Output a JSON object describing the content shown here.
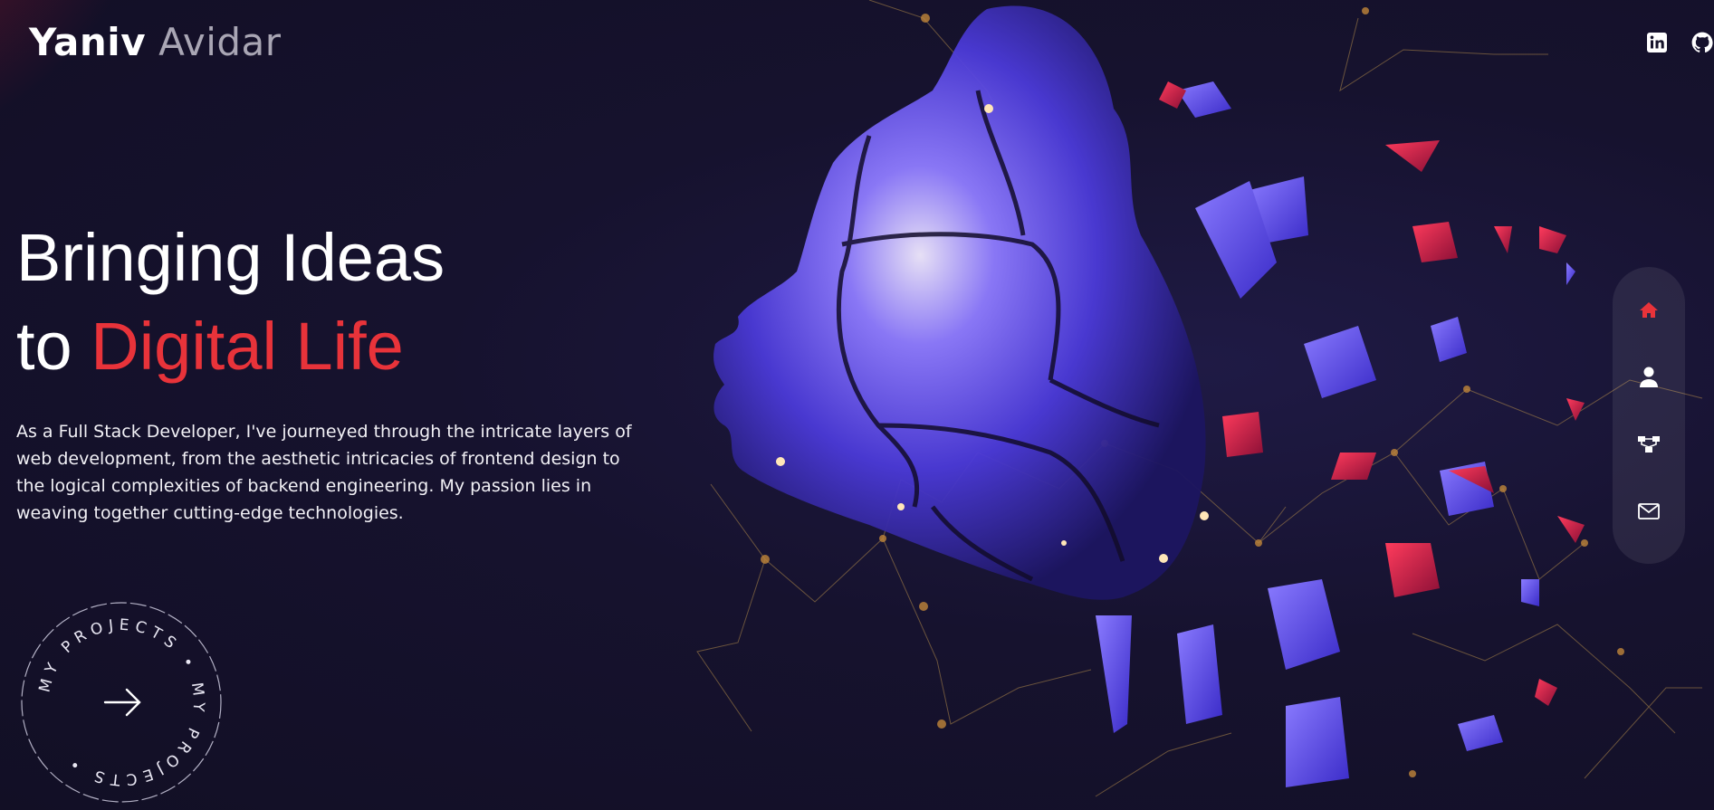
{
  "header": {
    "logo_first": "Yaniv",
    "logo_last": "Avidar"
  },
  "social": [
    {
      "name": "linkedin-icon",
      "label": "LinkedIn"
    },
    {
      "name": "github-icon",
      "label": "GitHub"
    }
  ],
  "hero": {
    "headline_line1": "Bringing Ideas",
    "headline_line2_prefix": "to ",
    "headline_line2_accent": "Digital Life",
    "intro": "As a Full Stack Developer, I've journeyed through the intricate layers of web development, from the aesthetic intricacies of frontend design to the logical complexities of backend engineering. My passion lies in weaving together cutting-edge technologies."
  },
  "projects_badge": {
    "ring_text": "MY PROJECTS • MY PROJECTS •",
    "arrow": "→"
  },
  "side_nav": {
    "items": [
      {
        "name": "home-icon",
        "active": true
      },
      {
        "name": "user-icon",
        "active": false
      },
      {
        "name": "sitemap-icon",
        "active": false
      },
      {
        "name": "mail-icon",
        "active": false
      }
    ]
  },
  "colors": {
    "accent": "#e8333a",
    "background": "#15122a",
    "text": "#ffffff",
    "muted": "#a9a6b4",
    "art_blue": "#5a48f0",
    "art_red": "#e0203c"
  }
}
